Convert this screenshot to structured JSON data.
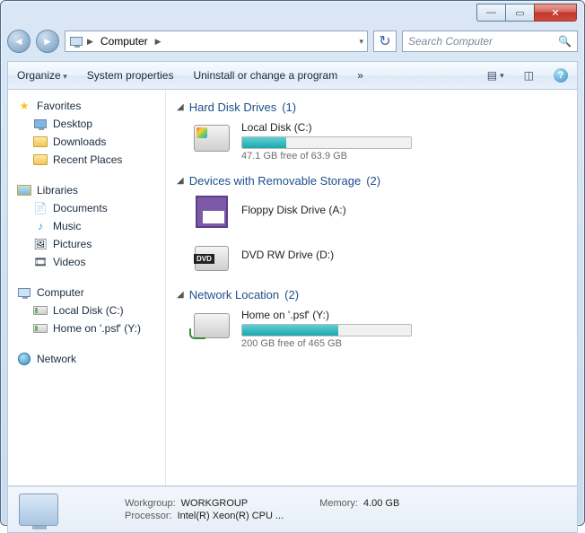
{
  "address": {
    "location": "Computer"
  },
  "search": {
    "placeholder": "Search Computer"
  },
  "toolbar": {
    "organize": "Organize",
    "system_properties": "System properties",
    "uninstall": "Uninstall or change a program",
    "more": "»"
  },
  "nav": {
    "favorites": {
      "label": "Favorites",
      "items": [
        "Desktop",
        "Downloads",
        "Recent Places"
      ]
    },
    "libraries": {
      "label": "Libraries",
      "items": [
        "Documents",
        "Music",
        "Pictures",
        "Videos"
      ]
    },
    "computer": {
      "label": "Computer",
      "items": [
        "Local Disk (C:)",
        "Home on '.psf' (Y:)"
      ]
    },
    "network": {
      "label": "Network"
    }
  },
  "sections": {
    "hdd": {
      "title": "Hard Disk Drives",
      "count": "(1)",
      "drives": [
        {
          "name": "Local Disk (C:)",
          "free_text": "47.1 GB free of 63.9 GB",
          "used_pct": 26
        }
      ]
    },
    "removable": {
      "title": "Devices with Removable Storage",
      "count": "(2)",
      "drives": [
        {
          "name": "Floppy Disk Drive (A:)"
        },
        {
          "name": "DVD RW Drive (D:)"
        }
      ]
    },
    "network": {
      "title": "Network Location",
      "count": "(2)",
      "drives": [
        {
          "name": "Home on '.psf' (Y:)",
          "free_text": "200 GB free of 465 GB",
          "used_pct": 57
        }
      ]
    }
  },
  "details": {
    "workgroup_label": "Workgroup:",
    "workgroup": "WORKGROUP",
    "memory_label": "Memory:",
    "memory": "4.00 GB",
    "processor_label": "Processor:",
    "processor": "Intel(R) Xeon(R) CPU   ..."
  }
}
